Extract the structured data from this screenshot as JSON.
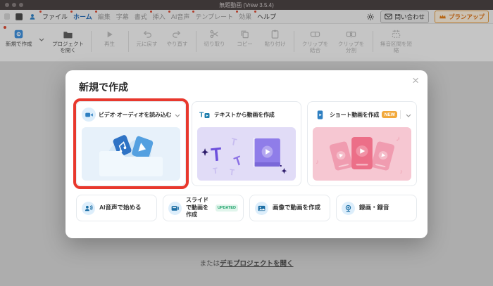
{
  "window": {
    "title": "無題動画 (Vrew 3.5.4)"
  },
  "menu_bar": {
    "items": [
      {
        "label": "ファイル"
      },
      {
        "label": "ホーム"
      },
      {
        "label": "編集"
      },
      {
        "label": "字幕"
      },
      {
        "label": "書式"
      },
      {
        "label": "挿入"
      },
      {
        "label": "AI音声"
      },
      {
        "label": "テンプレート"
      },
      {
        "label": "効果"
      },
      {
        "label": "ヘルプ"
      }
    ],
    "contact_button": "問い合わせ",
    "plan_up_button": "プランアップ"
  },
  "toolbar": {
    "new_project": "新規で作成",
    "open_project": "プロジェクトを開く",
    "play": "再生",
    "undo": "元に戻す",
    "redo": "やり直す",
    "cut": "切り取り",
    "copy": "コピー",
    "paste": "貼り付け",
    "merge_clips": "クリップを結合",
    "split_clip": "クリップを分割",
    "shorten_silence": "無音区間を短縮"
  },
  "modal": {
    "title": "新規で作成",
    "close_glyph": "×",
    "cards": [
      {
        "label": "ビデオ·オーディオを読み込む"
      },
      {
        "label": "テキストから動画を作成"
      },
      {
        "label": "ショート動画を作成",
        "badge": "NEW"
      }
    ],
    "quick_actions": [
      {
        "label": "AI音声で始める"
      },
      {
        "label": "スライドで動画を作成",
        "badge": "UPDATED"
      },
      {
        "label": "画像で動画を作成"
      },
      {
        "label": "録画・録音"
      }
    ]
  },
  "footer": {
    "prefix": "または",
    "link_label": "デモプロジェクトを開く"
  },
  "colors": {
    "highlight_red": "#e8382d",
    "active_tab_blue": "#2a6db5",
    "plan_up_orange": "#d9731a",
    "new_badge_bg": "#f2a93b",
    "updated_badge_green": "#1ea36a",
    "primary_blue": "#2e7fc1"
  }
}
